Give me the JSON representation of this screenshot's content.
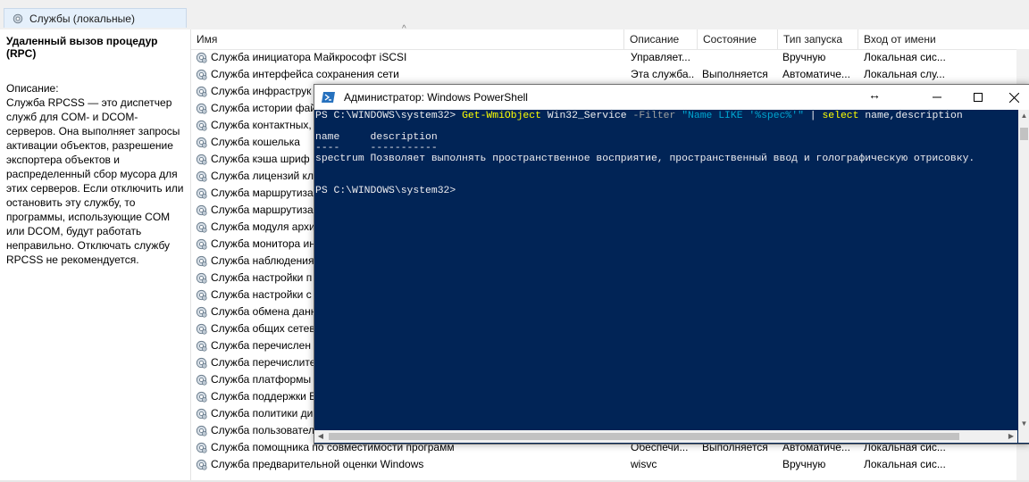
{
  "window": {
    "tab_title": "Службы (локальные)"
  },
  "description_pane": {
    "service_title": "Удаленный вызов процедур (RPC)",
    "caption": "Описание:",
    "text": "Служба RPCSS — это диспетчер\nслужб для COM- и DCOM-\nсерверов. Она выполняет запросы\nактивации объектов, разрешение\nэкспортера объектов и\nраспределенный сбор мусора для\nэтих серверов. Если отключить или\nостановить эту службу, то\nпрограммы, использующие COM\nили DCOM, будут работать\nнеправильно. Отключать службу\nRPCSS не рекомендуется."
  },
  "columns": {
    "name": "Имя",
    "description": "Описание",
    "status": "Состояние",
    "startup": "Тип запуска",
    "logon": "Вход от имени"
  },
  "services": [
    {
      "name": "Служба инициатора Майкрософт iSCSI",
      "description": "Управляет...",
      "status": "",
      "startup": "Вручную",
      "logon": "Локальная сис..."
    },
    {
      "name": "Служба интерфейса сохранения сети",
      "description": "Эта служба...",
      "status": "Выполняется",
      "startup": "Автоматиче...",
      "logon": "Локальная слу..."
    },
    {
      "name": "Служба инфраструк",
      "description": "",
      "status": "",
      "startup": "",
      "logon": ""
    },
    {
      "name": "Служба истории фай",
      "description": "",
      "status": "",
      "startup": "",
      "logon": ""
    },
    {
      "name": "Служба контактных,",
      "description": "",
      "status": "",
      "startup": "",
      "logon": ""
    },
    {
      "name": "Служба кошелька",
      "description": "",
      "status": "",
      "startup": "",
      "logon": ""
    },
    {
      "name": "Служба кэша шриф",
      "description": "",
      "status": "",
      "startup": "",
      "logon": ""
    },
    {
      "name": "Служба лицензий кл",
      "description": "",
      "status": "",
      "startup": "",
      "logon": ""
    },
    {
      "name": "Служба маршрутиза",
      "description": "",
      "status": "",
      "startup": "",
      "logon": ""
    },
    {
      "name": "Служба маршрутиза",
      "description": "",
      "status": "",
      "startup": "",
      "logon": ""
    },
    {
      "name": "Служба модуля архи",
      "description": "",
      "status": "",
      "startup": "",
      "logon": ""
    },
    {
      "name": "Служба монитора ин",
      "description": "",
      "status": "",
      "startup": "",
      "logon": ""
    },
    {
      "name": "Служба наблюдения",
      "description": "",
      "status": "",
      "startup": "",
      "logon": ""
    },
    {
      "name": "Служба настройки п",
      "description": "",
      "status": "",
      "startup": "",
      "logon": ""
    },
    {
      "name": "Служба настройки с",
      "description": "",
      "status": "",
      "startup": "",
      "logon": ""
    },
    {
      "name": "Служба обмена данн",
      "description": "",
      "status": "",
      "startup": "",
      "logon": ""
    },
    {
      "name": "Служба общих сетев",
      "description": "",
      "status": "",
      "startup": "",
      "logon": ""
    },
    {
      "name": "Служба перечислен",
      "description": "",
      "status": "",
      "startup": "",
      "logon": ""
    },
    {
      "name": "Служба перечислите",
      "description": "",
      "status": "",
      "startup": "",
      "logon": ""
    },
    {
      "name": "Служба платформы",
      "description": "",
      "status": "",
      "startup": "",
      "logon": ""
    },
    {
      "name": "Служба поддержки Б",
      "description": "",
      "status": "",
      "startup": "",
      "logon": ""
    },
    {
      "name": "Служба политики ди",
      "description": "",
      "status": "",
      "startup": "",
      "logon": ""
    },
    {
      "name": "Служба пользовател",
      "description": "",
      "status": "",
      "startup": "",
      "logon": ""
    },
    {
      "name": "Служба помощника по совместимости программ",
      "description": "Обеспечи...",
      "status": "Выполняется",
      "startup": "Автоматиче...",
      "logon": "Локальная сис..."
    },
    {
      "name": "Служба предварительной оценки Windows",
      "description": "wisvc",
      "status": "",
      "startup": "Вручную",
      "logon": "Локальная сис..."
    }
  ],
  "powershell": {
    "title": "Администратор: Windows PowerShell",
    "prompt": "PS C:\\WINDOWS\\system32>",
    "cmdlet": "Get-WmiObject",
    "arg": "Win32_Service",
    "param": "-Filter",
    "filter_string": "\"Name LIKE '%spec%'\"",
    "pipe": "|",
    "select_cmd": "select",
    "select_args": "name,description",
    "header_line": "name     description",
    "underline": "----     -----------",
    "result_line": "spectrum Позволяет выполнять пространственное восприятие, пространственный ввод и голографическую отрисовку.",
    "prompt_end": "PS C:\\WINDOWS\\system32>"
  }
}
